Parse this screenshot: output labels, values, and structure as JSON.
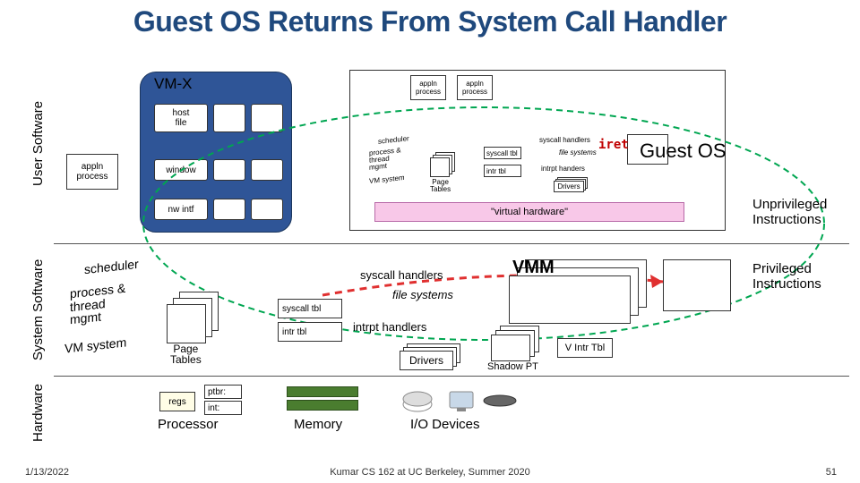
{
  "title": "Guest OS Returns From System Call Handler",
  "vertical_labels": {
    "user": "User Software",
    "system": "System Software",
    "hardware": "Hardware"
  },
  "user_layer": {
    "appln": "appln\nprocess",
    "vmx": "VM-X",
    "vmx_items": {
      "hostfile": "host\nfile",
      "window": "window",
      "nwintf": "nw intf"
    },
    "mini": {
      "appln1": "appln\nprocess",
      "appln2": "appln\nprocess",
      "scheduler": "scheduler",
      "ptm": "process &\nthread\nmgmt",
      "vmsystem": "VM system",
      "page_tables": "Page\nTables",
      "syscall_handlers": "syscall handlers",
      "syscall_tbl": "syscall tbl",
      "file_systems": "file systems",
      "intr_tbl": "intr tbl",
      "intrpt_handlers": "intrpt handers",
      "drivers": "Drivers",
      "virtual_hw": "\"virtual hardware\""
    },
    "iret": "iret",
    "guest_os": "Guest OS"
  },
  "side": {
    "unpriv": "Unprivileged\nInstructions",
    "priv": "Privileged\nInstructions"
  },
  "system_layer": {
    "scheduler": "scheduler",
    "ptm": "process &\nthread\nmgmt",
    "vmsystem": "VM system",
    "page_tables": "Page\nTables",
    "syscall_tbl": "syscall tbl",
    "intr_tbl": "intr tbl",
    "syscall_handlers": "syscall handlers",
    "file_systems": "file systems",
    "intrpt_handlers": "intrpt handlers",
    "drivers": "Drivers",
    "vmm": "VMM",
    "shadow_pt": "Shadow PT",
    "v_intr_tbl": "V Intr Tbl"
  },
  "hardware": {
    "regs": "regs",
    "ptbr": "ptbr:",
    "int": "int:",
    "processor": "Processor",
    "memory": "Memory",
    "io": "I/O Devices"
  },
  "footer": {
    "date": "1/13/2022",
    "center": "Kumar CS 162 at UC Berkeley, Summer 2020",
    "page": "51"
  }
}
